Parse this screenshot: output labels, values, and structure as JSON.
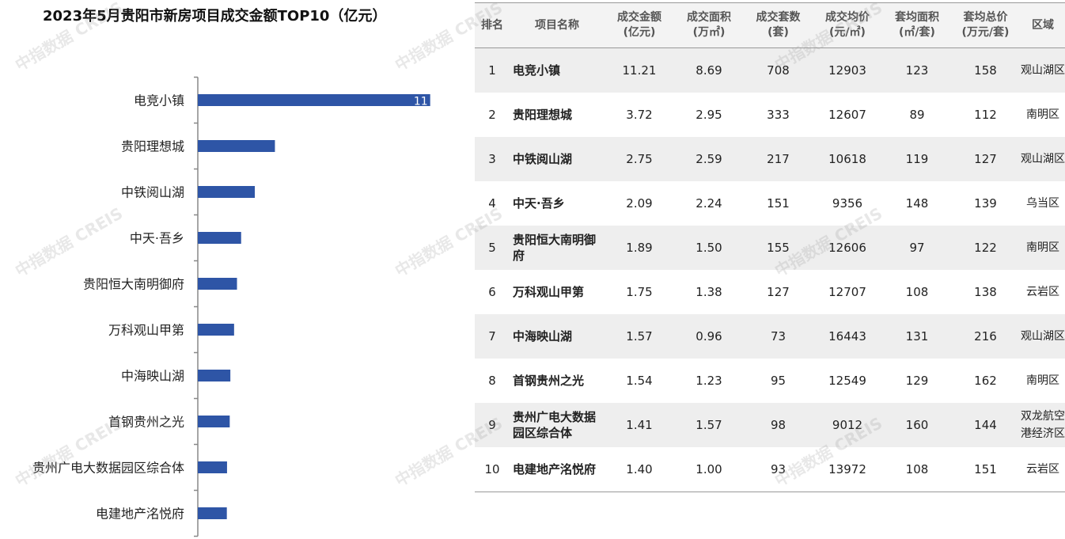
{
  "chart_data": {
    "type": "bar",
    "orientation": "horizontal",
    "title": "2023年5月贵阳市新房项目成交金额TOP10（亿元）",
    "categories": [
      "电竞小镇",
      "贵阳理想城",
      "中铁阅山湖",
      "中天·吾乡",
      "贵阳恒大南明御府",
      "万科观山甲第",
      "中海映山湖",
      "首钢贵州之光",
      "贵州广电大数据园区综合体",
      "电建地产洺悦府"
    ],
    "values": [
      11.21,
      3.72,
      2.75,
      2.09,
      1.89,
      1.75,
      1.57,
      1.54,
      1.41,
      1.4
    ],
    "data_labels": [
      {
        "category": "电竞小镇",
        "text": "11"
      }
    ],
    "xlim": [
      0,
      12
    ],
    "bar_color": "#2e55a6",
    "grid": false
  },
  "table": {
    "headers": [
      {
        "line1": "排名",
        "line2": ""
      },
      {
        "line1": "项目名称",
        "line2": ""
      },
      {
        "line1": "成交金额",
        "line2": "(亿元)"
      },
      {
        "line1": "成交面积",
        "line2": "(万㎡)"
      },
      {
        "line1": "成交套数",
        "line2": "(套)"
      },
      {
        "line1": "成交均价",
        "line2": "(元/㎡)"
      },
      {
        "line1": "套均面积",
        "line2": "(㎡/套)"
      },
      {
        "line1": "套均总价",
        "line2": "(万元/套)"
      },
      {
        "line1": "区域",
        "line2": ""
      }
    ],
    "rows": [
      [
        "1",
        "电竞小镇",
        "11.21",
        "8.69",
        "708",
        "12903",
        "123",
        "158",
        "观山湖区"
      ],
      [
        "2",
        "贵阳理想城",
        "3.72",
        "2.95",
        "333",
        "12607",
        "89",
        "112",
        "南明区"
      ],
      [
        "3",
        "中铁阅山湖",
        "2.75",
        "2.59",
        "217",
        "10618",
        "119",
        "127",
        "观山湖区"
      ],
      [
        "4",
        "中天·吾乡",
        "2.09",
        "2.24",
        "151",
        "9356",
        "148",
        "139",
        "乌当区"
      ],
      [
        "5",
        "贵阳恒大南明御府",
        "1.89",
        "1.50",
        "155",
        "12606",
        "97",
        "122",
        "南明区"
      ],
      [
        "6",
        "万科观山甲第",
        "1.75",
        "1.38",
        "127",
        "12707",
        "108",
        "138",
        "云岩区"
      ],
      [
        "7",
        "中海映山湖",
        "1.57",
        "0.96",
        "73",
        "16443",
        "131",
        "216",
        "观山湖区"
      ],
      [
        "8",
        "首钢贵州之光",
        "1.54",
        "1.23",
        "95",
        "12549",
        "129",
        "162",
        "南明区"
      ],
      [
        "9",
        "贵州广电大数据园区综合体",
        "1.41",
        "1.57",
        "98",
        "9012",
        "160",
        "144",
        "双龙航空港经济区"
      ],
      [
        "10",
        "电建地产洺悦府",
        "1.40",
        "1.00",
        "93",
        "13972",
        "108",
        "151",
        "云岩区"
      ]
    ]
  },
  "watermark": "中指数据 CREIS"
}
